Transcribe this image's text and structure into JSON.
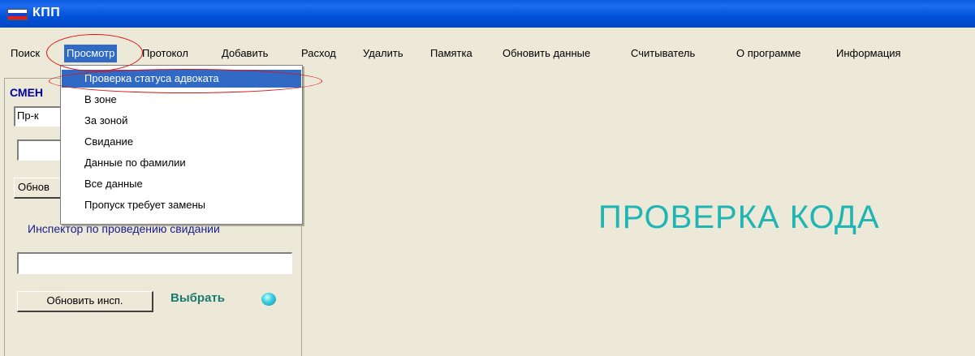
{
  "window": {
    "title": "КПП"
  },
  "menu": {
    "items": [
      {
        "label": "Поиск"
      },
      {
        "label": "Просмотр",
        "active": true
      },
      {
        "label": "Протокол"
      },
      {
        "label": "Добавить"
      },
      {
        "label": "Расход"
      },
      {
        "label": "Удалить"
      },
      {
        "label": "Памятка"
      },
      {
        "label": "Обновить данные"
      },
      {
        "label": "Считыватель"
      },
      {
        "label": "О программе"
      },
      {
        "label": "Информация"
      }
    ]
  },
  "dropdown": {
    "items": [
      {
        "label": "Проверка статуса адвоката",
        "highlighted": true
      },
      {
        "label": "В зоне"
      },
      {
        "label": "За зоной"
      },
      {
        "label": "Свидание"
      },
      {
        "label": "Данные по фамилии"
      },
      {
        "label": "Все данные"
      },
      {
        "label": "Пропуск требует замены"
      }
    ]
  },
  "left_panel": {
    "group_title": "СМЕН",
    "combo_value": "Пр-к",
    "second_field_value": "",
    "refresh_button_label": "Обнов",
    "inspector_label": "Инспектор по проведению свиданий",
    "inspector_field_value": "",
    "refresh_inspector_button_label": "Обновить инсп.",
    "choose_label": "Выбрать"
  },
  "main": {
    "status_text": "ПРОВЕРКА КОДА"
  },
  "colors": {
    "menu_highlight": "#316ac5",
    "status_text": "#1fb5b5",
    "annotation": "#e01010",
    "led": "#3fd0e0"
  }
}
